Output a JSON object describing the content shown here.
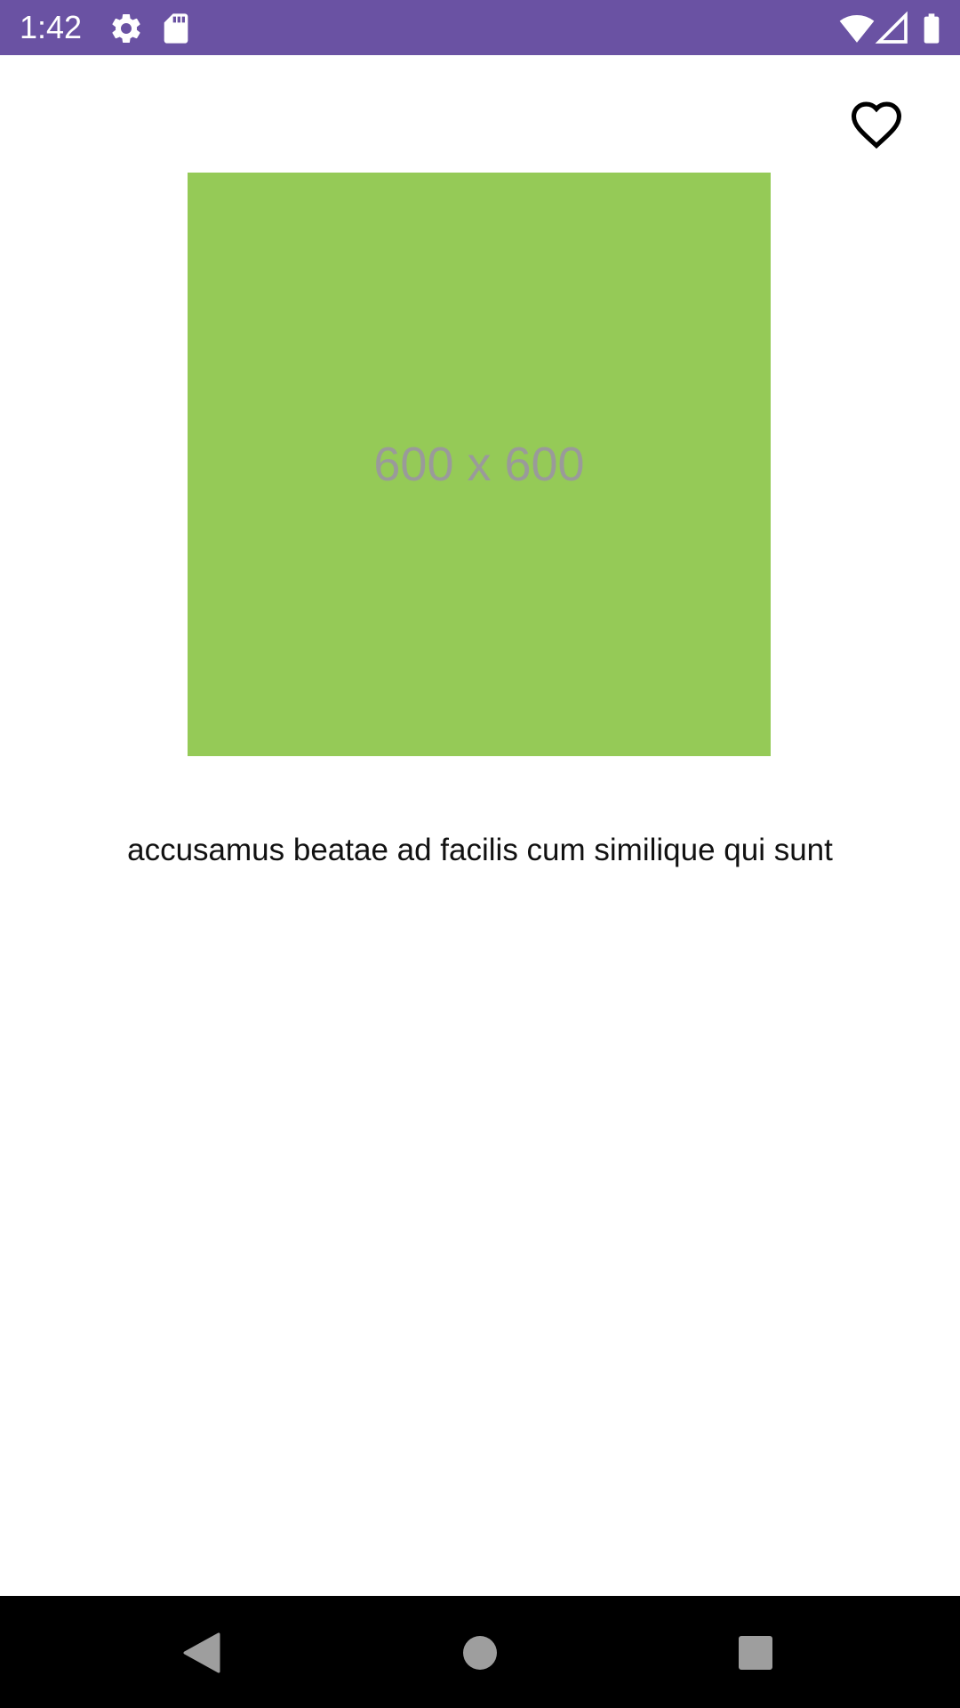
{
  "status_bar": {
    "time": "1:42",
    "background_color": "#6a52a3",
    "left_icons": [
      "settings-icon",
      "sd-card-icon"
    ],
    "right_icons": [
      "wifi-icon",
      "signal-icon",
      "battery-icon"
    ]
  },
  "toolbar": {
    "favorite_icon": "heart-outline-icon"
  },
  "image": {
    "placeholder_label": "600 x 600",
    "background_color": "#95ca57"
  },
  "content": {
    "title": "accusamus beatae ad facilis cum similique qui sunt"
  },
  "nav_bar": {
    "buttons": [
      "back-icon",
      "home-icon",
      "recents-icon"
    ]
  }
}
